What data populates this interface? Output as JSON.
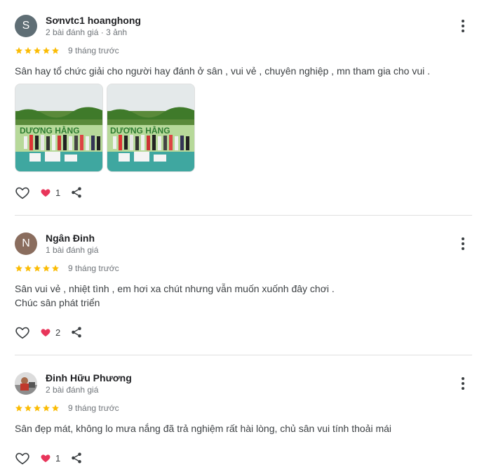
{
  "colors": {
    "star": "#fbbc04",
    "heart": "#e8355a",
    "avatar_s": "#5f6e75",
    "avatar_n": "#8a6d5e"
  },
  "reviews": [
    {
      "avatar_letter": "S",
      "name": "Sơnvtc1 hoanghong",
      "meta": "2 bài đánh giá · 3 ảnh",
      "rating": 5,
      "time": "9 tháng trước",
      "text_lines": [
        "Sân hay tổ chức giải cho người hay đánh ở sân , vui vẻ , chuyên nghiệp , mn tham gia cho vui ."
      ],
      "photos": [
        {
          "banner": "DƯƠNG HẰNG"
        },
        {
          "banner": "DƯƠNG HẰNG"
        }
      ],
      "reaction_count": "1"
    },
    {
      "avatar_letter": "N",
      "name": "Ngân Đinh",
      "meta": "1 bài đánh giá",
      "rating": 5,
      "time": "9 tháng trước",
      "text_lines": [
        "Sân vui vẻ , nhiệt tình , em hơi xa chút nhưng vẫn muốn xuốnh đây chơi .",
        "Chúc sân phát triển"
      ],
      "reaction_count": "2"
    },
    {
      "avatar_letter": "",
      "name": "Đinh Hữu Phương",
      "meta": "2 bài đánh giá",
      "rating": 5,
      "time": "9 tháng trước",
      "text_lines": [
        "Sân đẹp mát, không lo mưa nắng đã trả nghiệm rất hài lòng, chủ sân vui tính thoải mái"
      ],
      "reaction_count": "1"
    }
  ]
}
